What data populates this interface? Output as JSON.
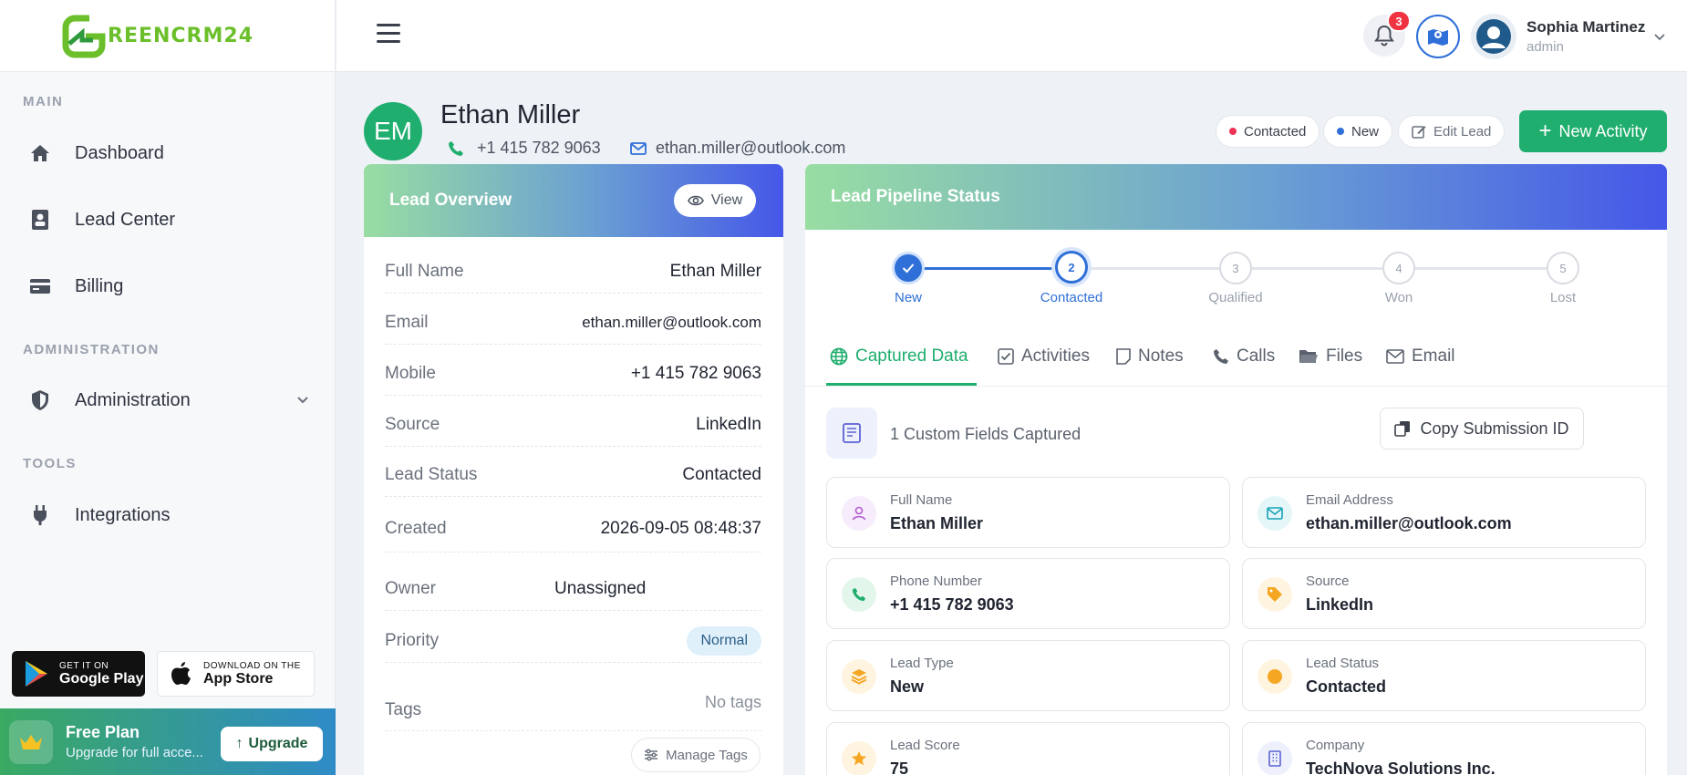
{
  "brand": {
    "logo_text": "REENCRM24"
  },
  "sidebar": {
    "sections": {
      "main": "MAIN",
      "administration": "ADMINISTRATION",
      "tools": "TOOLS"
    },
    "items": [
      {
        "label": "Dashboard",
        "icon": "home-icon"
      },
      {
        "label": "Lead Center",
        "icon": "contact-book-icon"
      },
      {
        "label": "Billing",
        "icon": "credit-card-icon"
      },
      {
        "label": "Administration",
        "icon": "shield-icon"
      },
      {
        "label": "Integrations",
        "icon": "plug-icon"
      }
    ],
    "stores": {
      "google_small": "GET IT ON",
      "google_big": "Google Play",
      "apple_small": "DOWNLOAD ON THE",
      "apple_big": "App Store"
    },
    "plan": {
      "title": "Free Plan",
      "subtitle": "Upgrade for full acce...",
      "upgrade": "Upgrade"
    }
  },
  "topbar": {
    "notification_count": "3",
    "user_name": "Sophia Martinez",
    "user_role": "admin"
  },
  "lead": {
    "initials": "EM",
    "name": "Ethan Miller",
    "phone": "+1 415 782 9063",
    "email": "ethan.miller@outlook.com",
    "status_pill": "Contacted",
    "type_pill": "New",
    "edit_label": "Edit Lead",
    "new_activity_label": "New Activity"
  },
  "overview": {
    "title": "Lead Overview",
    "view_label": "View",
    "rows": [
      {
        "key": "Full Name",
        "value": "Ethan Miller"
      },
      {
        "key": "Email",
        "value": "ethan.miller@outlook.com"
      },
      {
        "key": "Mobile",
        "value": "+1 415 782 9063"
      },
      {
        "key": "Source",
        "value": "LinkedIn"
      },
      {
        "key": "Lead Status",
        "value": "Contacted"
      },
      {
        "key": "Created",
        "value": "2026-09-05 08:48:37"
      },
      {
        "key": "Owner",
        "value": "Unassigned"
      },
      {
        "key": "Priority",
        "value": "Normal"
      },
      {
        "key": "Tags",
        "value": "No tags"
      }
    ],
    "manage_tags": "Manage Tags"
  },
  "pipeline": {
    "title": "Lead Pipeline Status",
    "steps": [
      {
        "num": "",
        "label": "New",
        "state": "done"
      },
      {
        "num": "2",
        "label": "Contacted",
        "state": "active"
      },
      {
        "num": "3",
        "label": "Qualified",
        "state": "pending"
      },
      {
        "num": "4",
        "label": "Won",
        "state": "pending"
      },
      {
        "num": "5",
        "label": "Lost",
        "state": "pending"
      }
    ],
    "tabs": [
      "Captured Data",
      "Activities",
      "Notes",
      "Calls",
      "Files",
      "Email"
    ],
    "active_tab": "Captured Data",
    "custom_fields_text": "1 Custom Fields Captured",
    "copy_label": "Copy Submission ID",
    "fields": [
      {
        "label": "Full Name",
        "value": "Ethan Miller",
        "icon": "user-icon"
      },
      {
        "label": "Email Address",
        "value": "ethan.miller@outlook.com",
        "icon": "mail-icon"
      },
      {
        "label": "Phone Number",
        "value": "+1 415 782 9063",
        "icon": "phone-icon"
      },
      {
        "label": "Source",
        "value": "LinkedIn",
        "icon": "tag-icon"
      },
      {
        "label": "Lead Type",
        "value": "New",
        "icon": "layers-icon"
      },
      {
        "label": "Lead Status",
        "value": "Contacted",
        "icon": "status-dot-icon"
      },
      {
        "label": "Lead Score",
        "value": "75",
        "icon": "star-icon"
      },
      {
        "label": "Company",
        "value": "TechNova Solutions Inc.",
        "icon": "building-icon"
      }
    ]
  },
  "colors": {
    "accent": "#1fae6e",
    "primary_blue": "#2f6fd8",
    "danger": "#ef3340"
  }
}
